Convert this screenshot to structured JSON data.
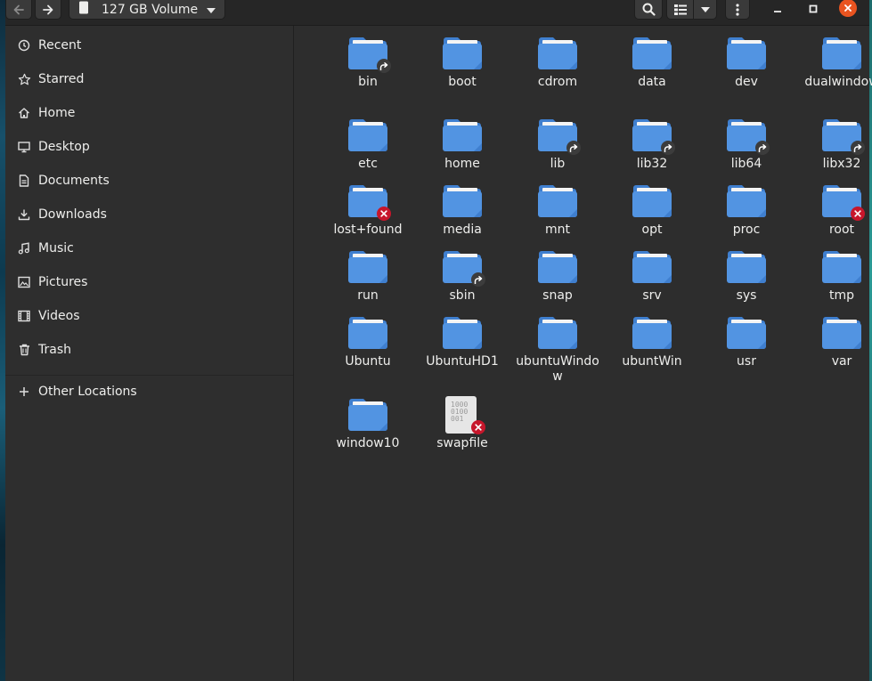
{
  "window": {
    "location_label": "127 GB Volume"
  },
  "colors": {
    "folder": "#5294e2",
    "folder_dark": "#3f7fcf",
    "accent_close": "#e95420",
    "unreadable_emblem": "#c7162b"
  },
  "toolbar": {
    "back_icon": "arrow-left-icon",
    "forward_icon": "arrow-right-icon",
    "search_icon": "search-icon",
    "view_icon": "list-view-icon",
    "view_options_icon": "chevron-down-icon",
    "menu_icon": "kebab-menu-icon",
    "minimize_icon": "minimize-icon",
    "maximize_icon": "maximize-icon",
    "close_icon": "close-icon"
  },
  "sidebar": {
    "items": [
      {
        "label": "Recent",
        "icon": "clock-icon"
      },
      {
        "label": "Starred",
        "icon": "star-icon"
      },
      {
        "label": "Home",
        "icon": "home-icon"
      },
      {
        "label": "Desktop",
        "icon": "desktop-icon"
      },
      {
        "label": "Documents",
        "icon": "document-icon"
      },
      {
        "label": "Downloads",
        "icon": "download-icon"
      },
      {
        "label": "Music",
        "icon": "music-icon"
      },
      {
        "label": "Pictures",
        "icon": "picture-icon"
      },
      {
        "label": "Videos",
        "icon": "video-icon"
      },
      {
        "label": "Trash",
        "icon": "trash-icon"
      }
    ],
    "other_locations": {
      "label": "Other Locations",
      "icon": "plus-icon"
    }
  },
  "files": [
    {
      "name": "bin",
      "type": "folder",
      "emblem": "symlink"
    },
    {
      "name": "boot",
      "type": "folder",
      "emblem": ""
    },
    {
      "name": "cdrom",
      "type": "folder",
      "emblem": ""
    },
    {
      "name": "data",
      "type": "folder",
      "emblem": ""
    },
    {
      "name": "dev",
      "type": "folder",
      "emblem": ""
    },
    {
      "name": "dualwindow",
      "type": "folder",
      "emblem": ""
    },
    {
      "name": "etc",
      "type": "folder",
      "emblem": ""
    },
    {
      "name": "home",
      "type": "folder",
      "emblem": ""
    },
    {
      "name": "lib",
      "type": "folder",
      "emblem": "symlink"
    },
    {
      "name": "lib32",
      "type": "folder",
      "emblem": "symlink"
    },
    {
      "name": "lib64",
      "type": "folder",
      "emblem": "symlink"
    },
    {
      "name": "libx32",
      "type": "folder",
      "emblem": "symlink"
    },
    {
      "name": "lost+found",
      "type": "folder",
      "emblem": "unreadable"
    },
    {
      "name": "media",
      "type": "folder",
      "emblem": ""
    },
    {
      "name": "mnt",
      "type": "folder",
      "emblem": ""
    },
    {
      "name": "opt",
      "type": "folder",
      "emblem": ""
    },
    {
      "name": "proc",
      "type": "folder",
      "emblem": ""
    },
    {
      "name": "root",
      "type": "folder",
      "emblem": "unreadable"
    },
    {
      "name": "run",
      "type": "folder",
      "emblem": ""
    },
    {
      "name": "sbin",
      "type": "folder",
      "emblem": "symlink"
    },
    {
      "name": "snap",
      "type": "folder",
      "emblem": ""
    },
    {
      "name": "srv",
      "type": "folder",
      "emblem": ""
    },
    {
      "name": "sys",
      "type": "folder",
      "emblem": ""
    },
    {
      "name": "tmp",
      "type": "folder",
      "emblem": ""
    },
    {
      "name": "Ubuntu",
      "type": "folder",
      "emblem": ""
    },
    {
      "name": "UbuntuHD1",
      "type": "folder",
      "emblem": ""
    },
    {
      "name": "ubuntuWindow",
      "type": "folder",
      "emblem": ""
    },
    {
      "name": "ubuntWin",
      "type": "folder",
      "emblem": ""
    },
    {
      "name": "usr",
      "type": "folder",
      "emblem": ""
    },
    {
      "name": "var",
      "type": "folder",
      "emblem": ""
    },
    {
      "name": "window10",
      "type": "folder",
      "emblem": ""
    },
    {
      "name": "swapfile",
      "type": "binary-file",
      "emblem": "unreadable",
      "preview_text": "1000\n0100\n001"
    }
  ]
}
